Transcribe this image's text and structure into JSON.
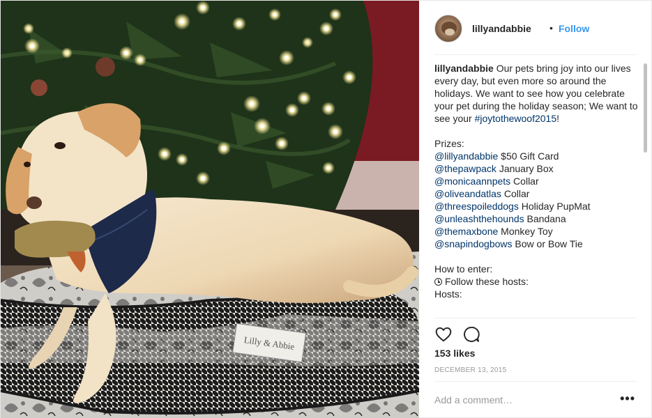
{
  "post": {
    "photo_alt": "",
    "photo_tag_text": "Lilly & Abbie"
  },
  "header": {
    "username": "lillyandabbie",
    "separator": "•",
    "follow_label": "Follow"
  },
  "caption": {
    "username": "lillyandabbie",
    "intro": " Our pets bring joy into our lives every day, but even more so around the holidays. We want to see how you celebrate your pet during the holiday season; We want to see your ",
    "hashtag": "#joytothewoof2015",
    "intro_end": "!",
    "prizes_title": "Prizes:",
    "prizes": [
      {
        "handle": "@lillyandabbie",
        "prize": " $50 Gift Card"
      },
      {
        "handle": "@thepawpack",
        "prize": " January Box"
      },
      {
        "handle": "@monicaannpets",
        "prize": " Collar"
      },
      {
        "handle": "@oliveandatlas",
        "prize": " Collar"
      },
      {
        "handle": "@threespoileddogs",
        "prize": " Holiday PupMat"
      },
      {
        "handle": "@unleashthehounds",
        "prize": " Bandana"
      },
      {
        "handle": "@themaxbone",
        "prize": " Monkey Toy"
      },
      {
        "handle": "@snapindogbows",
        "prize": " Bow or Bow Tie"
      }
    ],
    "how_to_enter": "How to enter:",
    "step1": "Follow these hosts:",
    "hosts_title": "Hosts:"
  },
  "actions": {
    "like_icon": "heart-icon",
    "comment_icon": "comment-bubble-icon"
  },
  "likes_text": "153 likes",
  "date_text": "DECEMBER 13, 2015",
  "comment": {
    "placeholder": "Add a comment…",
    "more_label": "•••"
  },
  "colors": {
    "link": "#003569",
    "follow": "#3897f0",
    "muted": "#999999",
    "text": "#262626"
  }
}
